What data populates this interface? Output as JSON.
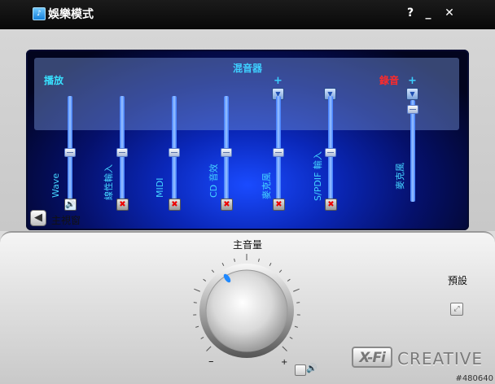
{
  "window": {
    "icon": "app-logo-icon",
    "title": "娛樂模式",
    "help": "?",
    "minimize": "_",
    "close": "✕"
  },
  "mixer": {
    "title": "混音器",
    "playback_label": "播放",
    "record_label": "錄音",
    "channels": [
      {
        "label": "Wave",
        "muted": false,
        "mute_icon": "🔊"
      },
      {
        "label": "線性輸入",
        "muted": true,
        "mute_icon": "✖"
      },
      {
        "label": "MIDI",
        "muted": true,
        "mute_icon": "✖"
      },
      {
        "label": "CD 音效",
        "muted": true,
        "mute_icon": "✖"
      },
      {
        "label": "麥克風",
        "muted": true,
        "mute_icon": "✖"
      },
      {
        "label": "S/PDIF 輸入",
        "muted": true,
        "mute_icon": "✖"
      }
    ],
    "record_channel": {
      "label": "麥克風"
    },
    "plus_sign": "+",
    "dropdown_glyph": "▼"
  },
  "nav": {
    "main_window_label": "主視窗",
    "back_glyph": "◀"
  },
  "master": {
    "label": "主音量",
    "minus_sign": "–",
    "plus_sign": "+"
  },
  "preset": {
    "label": "預設"
  },
  "brand": {
    "xfi": "X-Fi",
    "creative": "CREATIVE"
  },
  "watermark": "#480640",
  "colors": {
    "accent_cyan": "#38e1ff",
    "record_red": "#ff2a2a",
    "screen_blue": "#0a27b8"
  }
}
